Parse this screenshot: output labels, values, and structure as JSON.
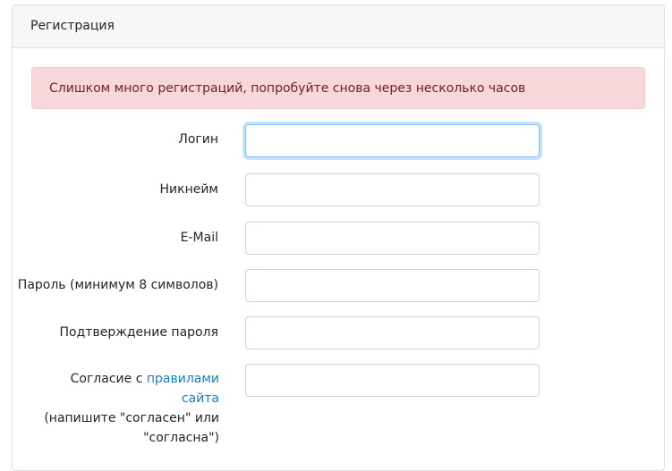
{
  "card": {
    "title": "Регистрация"
  },
  "alert": {
    "message": "Слишком много регистраций, попробуйте снова через несколько часов"
  },
  "form": {
    "login_label": "Логин",
    "nickname_label": "Никнейм",
    "email_label": "E-Mail",
    "password_label": "Пароль (минимум 8 символов)",
    "confirm_label": "Подтверждение пароля",
    "consent_prefix": "Согласие с ",
    "consent_link": "правилами сайта",
    "consent_suffix": "(напишите \"согласен\" или \"согласна\")",
    "login_value": "",
    "nickname_value": "",
    "email_value": "",
    "password_value": "",
    "confirm_value": "",
    "consent_value": ""
  }
}
